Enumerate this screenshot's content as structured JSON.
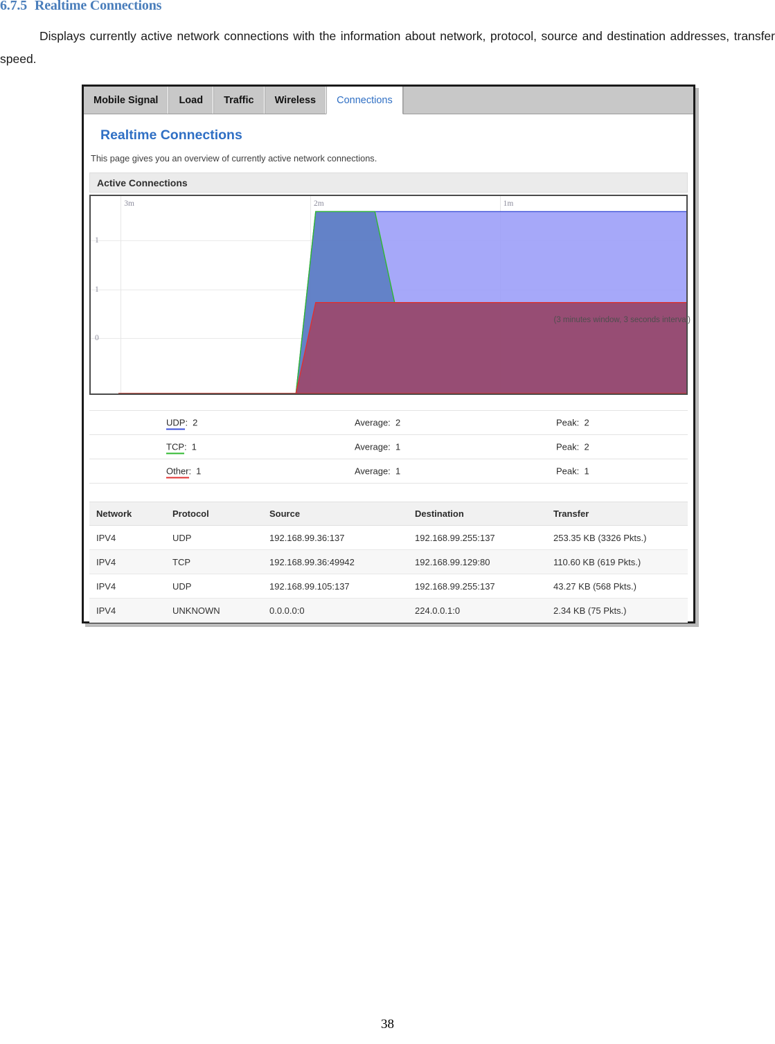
{
  "document": {
    "heading_number": "6.7.5",
    "heading_title": "Realtime Connections",
    "paragraph": "Displays currently active network connections with the information about network, protocol, source and destination addresses, transfer speed.",
    "page_number": "38"
  },
  "screenshot": {
    "tabs": [
      {
        "label": "Mobile Signal",
        "active": false
      },
      {
        "label": "Load",
        "active": false
      },
      {
        "label": "Traffic",
        "active": false
      },
      {
        "label": "Wireless",
        "active": false
      },
      {
        "label": "Connections",
        "active": true
      }
    ],
    "page_title": "Realtime Connections",
    "page_description": "This page gives you an overview of currently active network connections.",
    "section_header": "Active Connections",
    "chart_note": "(3 minutes window, 3 seconds interval)",
    "stats": [
      {
        "protocol": "UDP",
        "value": "2",
        "average_label": "Average:",
        "average": "2",
        "peak_label": "Peak:",
        "peak": "2",
        "color": "#3b4fd8"
      },
      {
        "protocol": "TCP",
        "value": "1",
        "average_label": "Average:",
        "average": "1",
        "peak_label": "Peak:",
        "peak": "2",
        "color": "#2fb82f"
      },
      {
        "protocol": "Other",
        "value": "1",
        "average_label": "Average:",
        "average": "1",
        "peak_label": "Peak:",
        "peak": "1",
        "color": "#e03030"
      }
    ],
    "table": {
      "columns": [
        "Network",
        "Protocol",
        "Source",
        "Destination",
        "Transfer"
      ],
      "rows": [
        {
          "network": "IPV4",
          "protocol": "UDP",
          "source": "192.168.99.36:137",
          "destination": "192.168.99.255:137",
          "transfer": "253.35 KB (3326 Pkts.)"
        },
        {
          "network": "IPV4",
          "protocol": "TCP",
          "source": "192.168.99.36:49942",
          "destination": "192.168.99.129:80",
          "transfer": "110.60 KB (619 Pkts.)"
        },
        {
          "network": "IPV4",
          "protocol": "UDP",
          "source": "192.168.99.105:137",
          "destination": "192.168.99.255:137",
          "transfer": "43.27 KB (568 Pkts.)"
        },
        {
          "network": "IPV4",
          "protocol": "UNKNOWN",
          "source": "0.0.0.0:0",
          "destination": "224.0.0.1:0",
          "transfer": "2.34 KB (75 Pkts.)"
        }
      ]
    }
  },
  "chart_data": {
    "type": "area",
    "title": "Active Connections",
    "xlabel": "",
    "ylabel": "",
    "x_tick_labels": [
      "3m",
      "2m",
      "1m"
    ],
    "x_tick_positions_pct": [
      5.0,
      36.6,
      68.2
    ],
    "y_tick_labels": [
      "1",
      "1",
      "0"
    ],
    "y_tick_positions_pct": [
      22.6,
      47.5,
      72.0
    ],
    "ylim": [
      0,
      2
    ],
    "grid": true,
    "legend_position": "below-chart",
    "annotation": "(3 minutes window, 3 seconds interval)",
    "series": [
      {
        "name": "UDP",
        "color": "#3b4fd8",
        "fill": "#9a9cf8",
        "values": [
          0,
          0,
          0,
          0,
          0,
          0,
          0,
          0,
          0,
          0,
          2,
          2,
          2,
          2,
          2,
          2,
          2,
          2,
          2,
          2,
          2,
          2,
          2,
          2,
          2,
          2,
          2,
          2,
          2,
          2
        ]
      },
      {
        "name": "TCP",
        "color": "#2fb82f",
        "fill": "#5a7cc0",
        "values": [
          0,
          0,
          0,
          0,
          0,
          0,
          0,
          0,
          0,
          0,
          2,
          2,
          2,
          2,
          1,
          1,
          1,
          1,
          1,
          1,
          1,
          1,
          1,
          1,
          1,
          1,
          1,
          1,
          1,
          1
        ]
      },
      {
        "name": "Other",
        "color": "#e03030",
        "fill": "#9e4568",
        "values": [
          0,
          0,
          0,
          0,
          0,
          0,
          0,
          0,
          0,
          0,
          1,
          1,
          1,
          1,
          1,
          1,
          1,
          1,
          1,
          1,
          1,
          1,
          1,
          1,
          1,
          1,
          1,
          1,
          1,
          1
        ]
      }
    ]
  }
}
